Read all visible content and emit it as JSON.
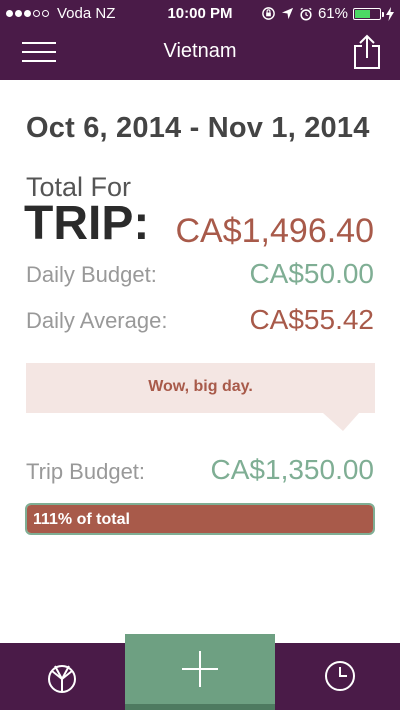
{
  "status_bar": {
    "carrier": "Voda NZ",
    "time": "10:00 PM",
    "battery_percent": "61%",
    "battery_level": 0.61,
    "signal_bars_filled": 3,
    "signal_bars_total": 5,
    "icons": [
      "lock-rotation-icon",
      "location-arrow-icon",
      "alarm-icon",
      "battery-icon",
      "charging-bolt-icon"
    ]
  },
  "nav": {
    "title": "Vietnam",
    "left_icon": "menu-icon",
    "right_icon": "share-icon"
  },
  "trip": {
    "date_range": "Oct 6, 2014 - Nov 1, 2014",
    "total_for_label": "Total For",
    "trip_label": "TRIP:",
    "total_value": "CA$1,496.40",
    "daily_budget_label": "Daily Budget:",
    "daily_budget_value": "CA$50.00",
    "daily_average_label": "Daily Average:",
    "daily_average_value": "CA$55.42",
    "message": "Wow, big day.",
    "trip_budget_label": "Trip Budget:",
    "trip_budget_value": "CA$1,350.00",
    "progress_label": "111% of total",
    "progress_fraction": 1.0
  },
  "tabbar": {
    "left_icon": "pie-chart-icon",
    "center_icon": "plus-icon",
    "right_icon": "clock-icon"
  },
  "colors": {
    "header_bg": "#4a1b48",
    "over_budget": "#a85a4a",
    "under_budget": "#7fae94",
    "add_button": "#6ea082",
    "bubble_bg": "#f4e6e3"
  }
}
